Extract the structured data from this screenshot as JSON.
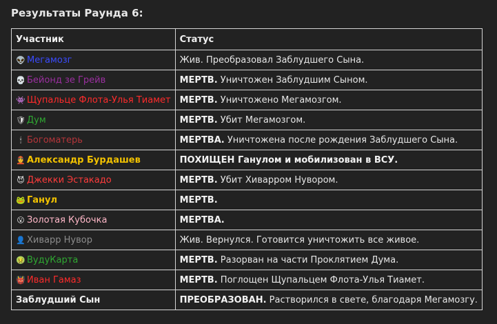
{
  "title": "Результаты Раунда 6:",
  "headers": {
    "participant": "Участник",
    "status": "Статус"
  },
  "rows": [
    {
      "icon": "👽",
      "icon_name": "alien-icon",
      "name": "Мегамозг",
      "color": "#3a4bff",
      "bold": false,
      "status_strong": "",
      "status_text": "Жив. Преобразовал Заблудшего Сына."
    },
    {
      "icon": "💀",
      "icon_name": "skull-icon",
      "name": "Бейонд зе Грейв",
      "color": "#9b2fa0",
      "bold": false,
      "status_strong": "МЕРТВ.",
      "status_text": " Уничтожен Заблудшим Сыном."
    },
    {
      "icon": "👾",
      "icon_name": "space-invader-icon",
      "name": "Щупальце Флота-Улья Тиамет",
      "color": "#ff2b2b",
      "bold": false,
      "status_strong": "МЕРТВ.",
      "status_text": " Уничтожено Мегамозгом."
    },
    {
      "icon": "🛡",
      "icon_name": "helmet-icon",
      "name": "Дум",
      "color": "#2fa832",
      "bold": false,
      "status_strong": "МЕРТВ.",
      "status_text": " Убит Мегамозгом."
    },
    {
      "icon": "🕯",
      "icon_name": "candle-icon",
      "name": "Богоматерь",
      "color": "#b5353a",
      "bold": false,
      "status_strong": "МЕРТВА.",
      "status_text": " Уничтожена после рождения Заблудшего Сына."
    },
    {
      "icon": "👲",
      "icon_name": "person-icon",
      "name": "Александр Бурдашев",
      "color": "#f2c200",
      "bold": true,
      "status_strong": "ПОХИЩЕН Ганулом и мобилизован в ВСУ.",
      "status_text": ""
    },
    {
      "icon": "😈",
      "icon_name": "devil-icon",
      "name": "Джекки Эстакадо",
      "color": "#ff3b3b",
      "bold": false,
      "status_strong": "МЕРТВ.",
      "status_text": " Убит Хиварром Нувором."
    },
    {
      "icon": "🐸",
      "icon_name": "frog-icon",
      "name": "Ганул",
      "color": "#f2c200",
      "bold": true,
      "status_strong": "МЕРТВ.",
      "status_text": ""
    },
    {
      "icon": "😮",
      "icon_name": "face-icon",
      "name": "Золотая Кубочка",
      "color": "#ffb8c8",
      "bold": false,
      "status_strong": "МЕРТВА.",
      "status_text": ""
    },
    {
      "icon": "👤",
      "icon_name": "figure-icon",
      "name": "Хиварр Нувор",
      "color": "#8c8c8c",
      "bold": false,
      "status_strong": "",
      "status_text": "Жив. Вернулся. Готовится уничтожить все живое."
    },
    {
      "icon": "🤢",
      "icon_name": "sick-face-icon",
      "name": "ВудуКарта",
      "color": "#2fa832",
      "bold": false,
      "status_strong": "МЕРТВ.",
      "status_text": " Разорван на части Проклятием Дума."
    },
    {
      "icon": "👹",
      "icon_name": "ogre-icon",
      "name": "Иван Гамаз",
      "color": "#ff2b2b",
      "bold": false,
      "status_strong": "МЕРТВ.",
      "status_text": " Поглощен Щупальцем Флота-Улья Тиамет."
    },
    {
      "icon": "",
      "icon_name": "",
      "name": "Заблудший Сын",
      "color": "#f0f0f0",
      "bold": true,
      "status_strong": "ПРЕОБРАЗОВАН.",
      "status_text": " Растворился в свете, благодаря Мегамозгу."
    }
  ]
}
